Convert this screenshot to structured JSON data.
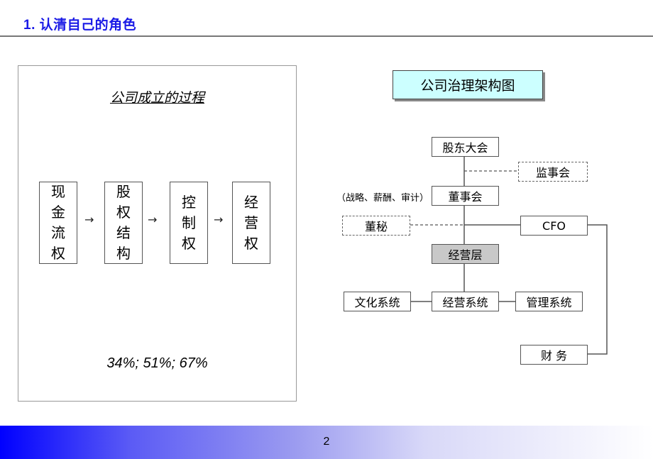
{
  "slide": {
    "title": "1. 认清自己的角色",
    "page_number": "2"
  },
  "left_panel": {
    "heading": "公司成立的过程",
    "flow": [
      {
        "label": "现金流权"
      },
      {
        "label": "股权结构"
      },
      {
        "label": "控制权"
      },
      {
        "label": "经营权"
      }
    ],
    "arrow": "→",
    "thresholds": "34%;  51%; 67%"
  },
  "org_chart": {
    "title": "公司治理架构图",
    "nodes": {
      "shareholders": "股东大会",
      "supervisory": "监事会",
      "board": "董事会",
      "board_note": "（战略、薪酬、审计）",
      "secretary": "董秘",
      "cfo": "CFO",
      "management": "经营层",
      "culture": "文化系统",
      "operation": "经营系统",
      "admin": "管理系统",
      "finance": "财 务"
    }
  }
}
